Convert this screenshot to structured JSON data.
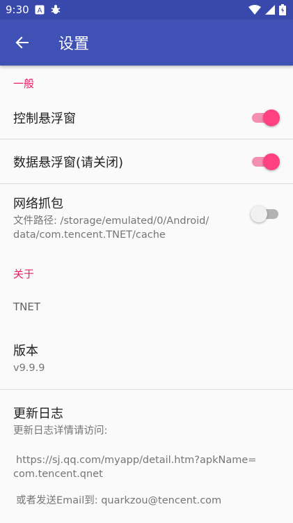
{
  "status_bar": {
    "time": "9:30",
    "notif_a": "A"
  },
  "app_bar": {
    "title": "设置"
  },
  "general": {
    "header": "一般",
    "control_float": {
      "title": "控制悬浮窗",
      "on": true
    },
    "data_float": {
      "title": "数据悬浮窗(请关闭)",
      "on": true
    },
    "capture": {
      "title": "网络抓包",
      "summary_line1": "文件路径: /storage/emulated/0/Android/",
      "summary_line2": "data/com.tencent.TNET/cache",
      "on": false
    }
  },
  "about": {
    "header": "关于",
    "app_name": "TNET",
    "version_title": "版本",
    "version_value": "v9.9.9",
    "changelog_title": "更新日志",
    "changelog_summary": "更新日志详情请访问:",
    "link_line1": "https://sj.qq.com/myapp/detail.htm?apkName=",
    "link_line2": "com.tencent.qnet",
    "email_line": "或者发送Email到: quarkzou@tencent.com"
  },
  "colors": {
    "primary": "#3f51b5",
    "status": "#3949ab",
    "accent": "#ff4081",
    "category": "#e91e63"
  }
}
